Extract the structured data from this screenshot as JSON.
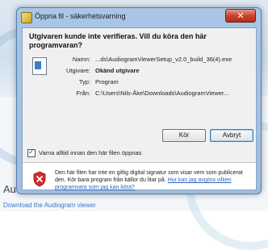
{
  "background": {
    "heading": "Aud",
    "link": "Download the Audiogram viewer"
  },
  "dialog": {
    "title": "Öppna fil - säkerhetsvarning",
    "close_symbol": "✕",
    "headline": "Utgivaren kunde inte verifieras. Vill du köra den här programvaran?",
    "fields": {
      "name_label": "Namn:",
      "name_value": "...ds\\AudiogramViewerSetup_v2.0_build_36(4).exe",
      "publisher_label": "Utgivare:",
      "publisher_value": "Okänd utgivare",
      "type_label": "Typ:",
      "type_value": "Program",
      "from_label": "Från:",
      "from_value": "C:\\Users\\Nils-Åke\\Downloads\\AudiogramViewer..."
    },
    "buttons": {
      "run": "Kör",
      "cancel": "Avbryt"
    },
    "checkbox": {
      "label": "Varna alltid innan den här filen öppnas",
      "checked": true
    },
    "warning": {
      "text": "Den här filen har inte en giltig digital signatur som visar vem som publicerat den. Kör bara program från källor du litar på. ",
      "link": "Hur kan jag avgöra vilken programvara som jag kan köra?"
    },
    "icons": {
      "file": "application-file-icon",
      "shield": "security-shield-icon"
    },
    "colors": {
      "close_button": "#c9452d",
      "shield_red": "#d22b2b",
      "link": "#2e64b8"
    }
  }
}
